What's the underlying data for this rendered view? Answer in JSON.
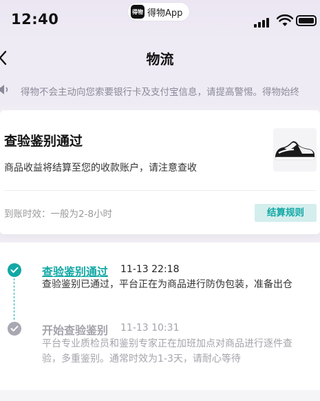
{
  "status_bar": {
    "time": "12:40",
    "app_name": "得物App",
    "app_logo_text": "得物"
  },
  "nav": {
    "title": "物流",
    "back_icon": "chevron-left-icon"
  },
  "notice": {
    "icon": "speaker-icon",
    "text": "得物不会主动向您索要银行卡及支付宝信息，请提高警惕。得物始终"
  },
  "status_card": {
    "title": "查验鉴别通过",
    "subtitle": "商品收益将结算至您的收款账户，请注意查收",
    "eta_text": "到账时效：一般为2-8小时",
    "rules_button": "结算规则",
    "accent_color": "#13a8a5"
  },
  "timeline": {
    "events": [
      {
        "title": "查验鉴别通过",
        "time": "11-13 22:18",
        "desc": "查验鉴别已通过，平台正在为商品进行防伪包装，准备出仓",
        "active": true
      },
      {
        "title": "开始查验鉴别",
        "time": "11-13 10:31",
        "desc_line1": "平台专业质检员和鉴别专家正在加班加点对商品进行逐件查",
        "desc_line2": "验，多重鉴别。通常时效为1-3天，请耐心等待",
        "active": false
      }
    ]
  }
}
